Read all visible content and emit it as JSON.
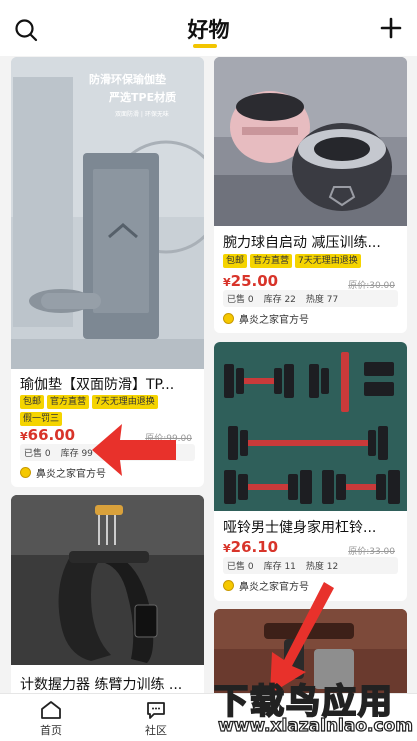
{
  "header": {
    "title": "好物"
  },
  "products": [
    {
      "name": "瑜伽垫【双面防滑】TP...",
      "tags": [
        "包邮",
        "官方直营",
        "7天无理由退换",
        "假一罚三"
      ],
      "price_currency": "¥",
      "price": "66.00",
      "original_price": "原价:99.00",
      "sold": "已售 0",
      "stock": "库存 99",
      "shop": "鼻炎之家官方号",
      "banner": {
        "line1": "防滑环保瑜伽垫",
        "line2": "严选TPE材质",
        "line3": "双面防滑 | 环保无味"
      }
    },
    {
      "name": "腕力球自启动 减压训练...",
      "tags": [
        "包邮",
        "官方直营",
        "7天无理由退换"
      ],
      "price_currency": "¥",
      "price": "25.00",
      "original_price": "原价:30.00",
      "sold": "已售 0",
      "stock": "库存 22",
      "heat": "热度 77",
      "shop": "鼻炎之家官方号"
    },
    {
      "name": "哑铃男士健身家用杠铃...",
      "price_currency": "¥",
      "price": "26.10",
      "original_price": "原价:33.00",
      "sold": "已售 0",
      "stock": "库存 11",
      "heat": "热度 12",
      "shop": "鼻炎之家官方号"
    },
    {
      "name": "计数握力器 练臂力训练 ..."
    }
  ],
  "nav": [
    {
      "label": "首页"
    },
    {
      "label": "社区"
    }
  ],
  "watermark": {
    "line1": "下载鸟应用",
    "line2": "www.xlazalnlao.com"
  },
  "colors": {
    "accent": "#f5d400",
    "price": "#d8342a",
    "arrow": "#e8312b"
  }
}
